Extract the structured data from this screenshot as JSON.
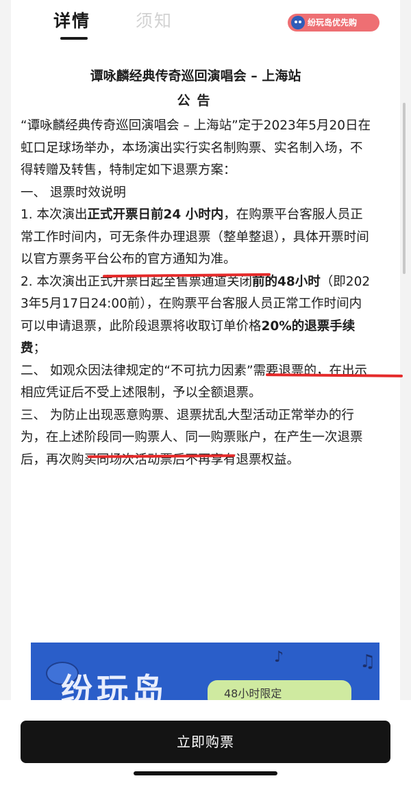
{
  "tabs": {
    "details": "详情",
    "notice": "须知"
  },
  "promo_badge": "纷玩岛优先购",
  "notice": {
    "title": "谭咏麟经典传奇巡回演唱会 – 上海站",
    "subtitle": "公告",
    "intro": "“谭咏麟经典传奇巡回演唱会 – 上海站”定于2023年5月20日在虹口足球场举办，本场演出实行实名制购票、实名制入场，不得转赠及转售，特制定如下退票方案：",
    "section1_heading": "一、 退票时效说明",
    "item1": {
      "prefix": "1. 本次演出",
      "highlight": "正式开票日前24 小时内",
      "suffix": "，在购票平台客服人员正常工作时间内，可无条件办理退票（整单整退），具体开票时间以官方票务平台公布的官方通知为准。"
    },
    "item2": {
      "prefix": "2. 本次演出正式开票日起至售票通道关闭",
      "highlight": "前的48小时",
      "middle": "（即2023年5月17日24:00前），在购票平台客服人员正常工作时间内可以申请退票，此阶段退票将收取订单价格",
      "highlight2": "20%的退票手续费",
      "suffix": "；"
    },
    "section2": "二、 如观众因法律规定的“不可抗力因素”需要退票的，在出示相应凭证后不受上述限制，予以全额退票。",
    "section3": "三、 为防止出现恶意购票、退票扰乱大型活动正常举办的行为，在上述阶段同一购票人、同一购票账户，在产生一次退票后，再次购买同场次活动票后不再享有退票权益。"
  },
  "banner": {
    "big_text": "纷玩岛",
    "pill_text": "48小时限定"
  },
  "buy_button": "立即购票",
  "colors": {
    "underline_red": "#e52a2a",
    "banner_blue": "#2a5ec9",
    "badge_pink": "#ee6f73",
    "button_dark": "#141414"
  }
}
